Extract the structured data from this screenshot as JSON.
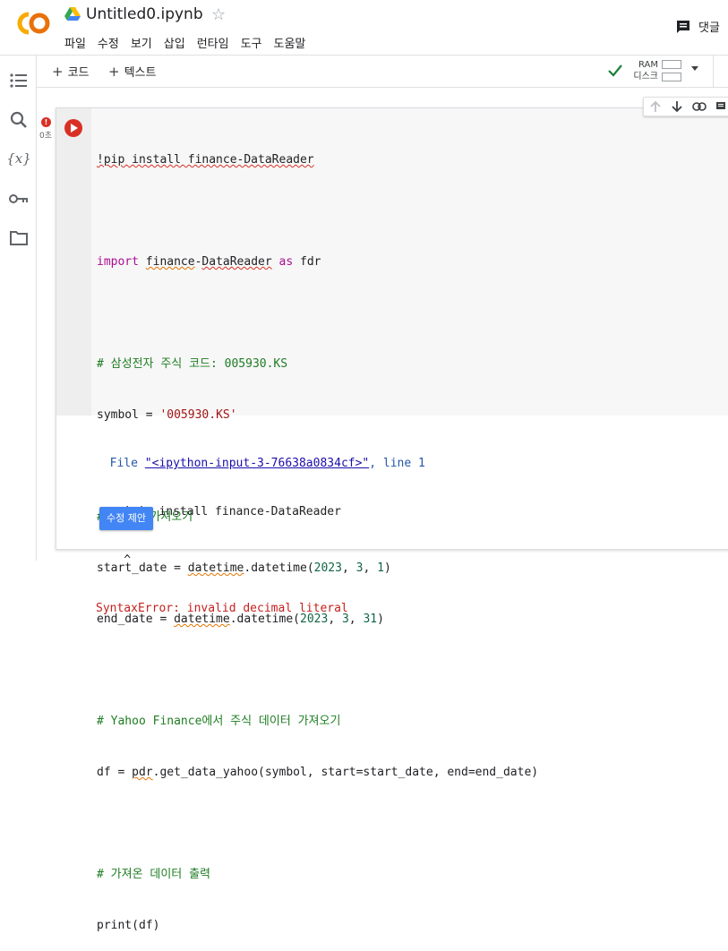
{
  "header": {
    "title": "Untitled0.ipynb",
    "menu": [
      "파일",
      "수정",
      "보기",
      "삽입",
      "런타임",
      "도구",
      "도움말"
    ],
    "comment_label": "댓글"
  },
  "toolbar": {
    "add_code": "코드",
    "add_text": "텍스트",
    "ram_label": "RAM",
    "disk_label": "디스크"
  },
  "cell": {
    "exec_time": "0초",
    "code_lines": [
      "!pip install finance-DataReader",
      "",
      "import finance-DataReader as fdr",
      "",
      "# 삼성전자 주식 코드: 005930.KS",
      "symbol = '005930.KS'",
      "",
      "# 데이터 가져오기",
      "start_date = datetime.datetime(2023, 3, 1)",
      "end_date = datetime.datetime(2023, 3, 31)",
      "",
      "# Yahoo Finance에서 주식 데이터 가져오기",
      "df = pdr.get_data_yahoo(symbol, start=start_date, end=end_date)",
      "",
      "# 가져온 데이터 출력",
      "print(df)"
    ],
    "output": {
      "file_prefix": "  File ",
      "file_link": "\"<ipython-input-3-76638a0834cf>\"",
      "file_suffix": ", line 1",
      "line2": "    !pip install finance-DataReader",
      "line3": "    ^",
      "error": "SyntaxError: invalid decimal literal"
    },
    "suggest_button": "수정 제안"
  }
}
